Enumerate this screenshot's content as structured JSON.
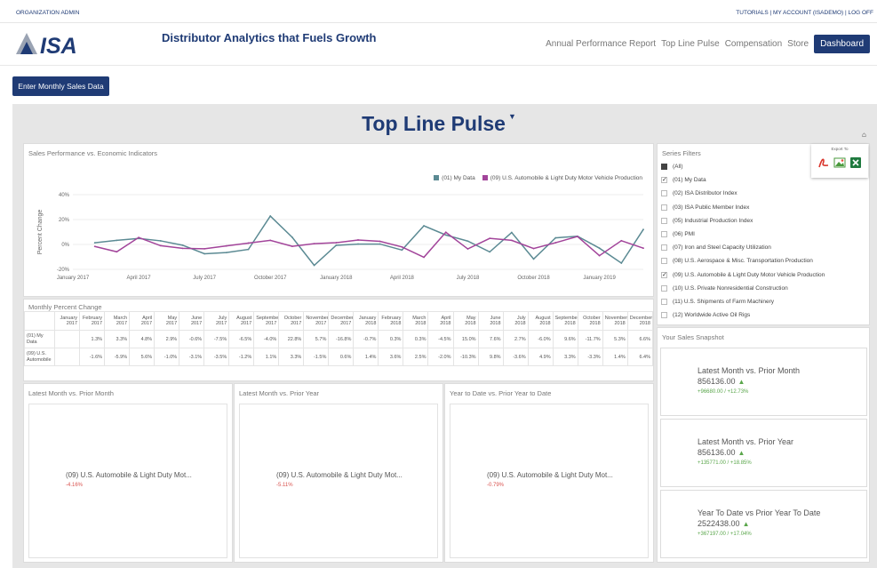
{
  "util": {
    "org": "ORGANIZATION ADMIN",
    "links": "TUTORIALS | MY ACCOUNT (ISADEMO) | LOG OFF"
  },
  "brand": {
    "logo_text": "ISA",
    "tagline": "Distributor Analytics that Fuels Growth"
  },
  "nav": {
    "items": [
      "Annual Performance Report",
      "Top Line Pulse",
      "Compensation",
      "Store"
    ],
    "active": "Dashboard"
  },
  "enter_button": "Enter Monthly Sales Data",
  "dashboard": {
    "title": "Top Line Pulse",
    "filter_glyph": "▼"
  },
  "chart_panel": {
    "title": "Sales Performance vs. Economic Indicators"
  },
  "chart_data": {
    "type": "line",
    "title": "",
    "ylabel": "Percent Change",
    "ylim": [
      -20,
      40
    ],
    "yticks": [
      "40%",
      "20%",
      "0%",
      "-20%"
    ],
    "x": [
      "Jan 2017",
      "Feb 2017",
      "Mar 2017",
      "Apr 2017",
      "May 2017",
      "Jun 2017",
      "Jul 2017",
      "Aug 2017",
      "Sep 2017",
      "Oct 2017",
      "Nov 2017",
      "Dec 2017",
      "Jan 2018",
      "Feb 2018",
      "Mar 2018",
      "Apr 2018",
      "May 2018",
      "Jun 2018",
      "Jul 2018",
      "Aug 2018",
      "Sep 2018",
      "Oct 2018",
      "Nov 2018",
      "Dec 2018",
      "Jan 2019",
      "Feb 2019",
      "Mar 2019"
    ],
    "xtick_labels": [
      "January 2017",
      "April 2017",
      "July 2017",
      "October 2017",
      "January 2018",
      "April 2018",
      "July 2018",
      "October 2018",
      "January 2019"
    ],
    "xtick_index": [
      0,
      3,
      6,
      9,
      12,
      15,
      18,
      21,
      24
    ],
    "grid": true,
    "legend_position": "top-right",
    "series": [
      {
        "name": "(01) My Data",
        "color": "#5b8a93",
        "values": [
          1.3,
          3.3,
          4.8,
          2.9,
          -0.6,
          -7.5,
          -6.5,
          -4.0,
          22.8,
          5.7,
          -16.8,
          -0.7,
          0.3,
          0.3,
          -4.5,
          15.0,
          7.6,
          2.7,
          -6.0,
          9.6,
          -11.7,
          5.3,
          6.6,
          -3.0,
          -15.0,
          12.0
        ]
      },
      {
        "name": "(09) U.S. Automobile & Light Duty Motor Vehicle Production",
        "color": "#a2449a",
        "values": [
          -1.6,
          -5.9,
          5.6,
          -1.0,
          -3.1,
          -3.5,
          -1.2,
          1.1,
          3.3,
          -1.5,
          0.6,
          1.4,
          3.6,
          2.5,
          -2.0,
          -10.3,
          9.8,
          -3.6,
          4.9,
          3.3,
          -3.3,
          1.4,
          6.4,
          -9.0,
          3.0,
          -3.0
        ]
      }
    ]
  },
  "monthly": {
    "title": "Monthly Percent Change",
    "headers": [
      "January 2017",
      "February 2017",
      "March 2017",
      "April 2017",
      "May 2017",
      "June 2017",
      "July 2017",
      "August 2017",
      "September 2017",
      "October 2017",
      "November 2017",
      "December 2017",
      "January 2018",
      "February 2018",
      "March 2018",
      "April 2018",
      "May 2018",
      "June 2018",
      "July 2018",
      "August 2018",
      "September 2018",
      "October 2018",
      "November 2018",
      "December 2018"
    ],
    "rows": [
      {
        "label": "(01) My Data",
        "cells": [
          "",
          "1.3%",
          "3.3%",
          "4.8%",
          "2.9%",
          "-0.6%",
          "-7.5%",
          "-6.5%",
          "-4.0%",
          "22.8%",
          "5.7%",
          "-16.8%",
          "-0.7%",
          "0.3%",
          "0.3%",
          "-4.5%",
          "15.0%",
          "7.6%",
          "2.7%",
          "-6.0%",
          "9.6%",
          "-11.7%",
          "5.3%",
          "6.6%"
        ]
      },
      {
        "label": "(09) U.S. Automobile",
        "cells": [
          "",
          "-1.6%",
          "-5.9%",
          "5.6%",
          "-1.0%",
          "-3.1%",
          "-3.5%",
          "-1.2%",
          "1.1%",
          "3.3%",
          "-1.5%",
          "0.6%",
          "1.4%",
          "3.6%",
          "2.5%",
          "-2.0%",
          "-10.3%",
          "9.8%",
          "-3.6%",
          "4.9%",
          "3.3%",
          "-3.3%",
          "1.4%",
          "6.4%"
        ]
      }
    ]
  },
  "bottom_panels": [
    {
      "title": "Latest Month vs. Prior Month",
      "name": "(09) U.S. Automobile & Light Duty Mot...",
      "value": "-4.16%"
    },
    {
      "title": "Latest Month vs. Prior Year",
      "name": "(09) U.S. Automobile & Light Duty Mot...",
      "value": "-5.11%"
    },
    {
      "title": "Year to Date vs. Prior Year to Date",
      "name": "(09) U.S. Automobile & Light Duty Mot...",
      "value": "-0.79%"
    }
  ],
  "filters": {
    "title": "Series Filters",
    "export_label": "Export To",
    "items": [
      {
        "label": "(All)",
        "state": "partial"
      },
      {
        "label": "(01) My Data",
        "state": "checked"
      },
      {
        "label": "(02) ISA Distributor Index",
        "state": "unchecked"
      },
      {
        "label": "(03) ISA Public Member Index",
        "state": "unchecked"
      },
      {
        "label": "(05) Industrial Production Index",
        "state": "unchecked"
      },
      {
        "label": "(06) PMI",
        "state": "unchecked"
      },
      {
        "label": "(07) Iron and Steel Capacity Utilization",
        "state": "unchecked"
      },
      {
        "label": "(08) U.S. Aerospace & Misc. Transportation Production",
        "state": "unchecked"
      },
      {
        "label": "(09) U.S. Automobile & Light Duty Motor Vehicle Production",
        "state": "checked"
      },
      {
        "label": "(10) U.S. Private Nonresidential Construction",
        "state": "unchecked"
      },
      {
        "label": "(11) U.S. Shipments of Farm Machinery",
        "state": "unchecked"
      },
      {
        "label": "(12) Worldwide Active Oil Rigs",
        "state": "unchecked"
      }
    ]
  },
  "snapshot": {
    "title": "Your Sales Snapshot",
    "cards": [
      {
        "label": "Latest Month vs. Prior Month",
        "value": "856136.00",
        "delta": "+96680.00 / +12.73%"
      },
      {
        "label": "Latest Month vs. Prior Year",
        "value": "856136.00",
        "delta": "+135771.00 / +18.85%"
      },
      {
        "label": "Year To Date vs Prior Year To Date",
        "value": "2522438.00",
        "delta": "+367197.00 / +17.04%"
      }
    ]
  },
  "colors": {
    "brand": "#1f3b75",
    "positive": "#5aa64b",
    "negative": "#d9534f"
  }
}
